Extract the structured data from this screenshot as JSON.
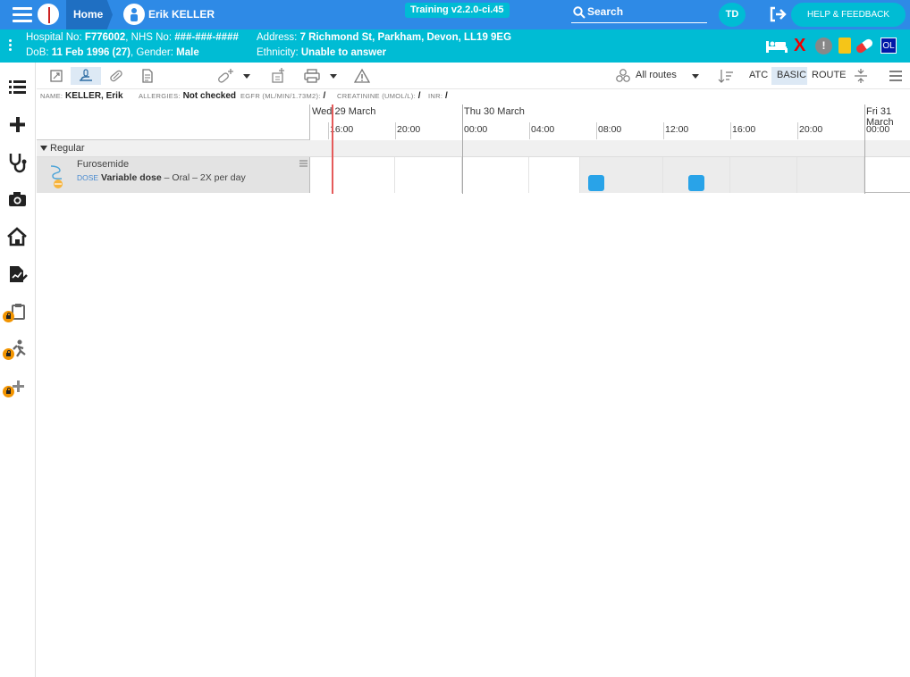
{
  "header": {
    "home_label": "Home",
    "patient_name": "Erik KELLER",
    "build_label": "Training v2.2.0-ci.45",
    "search_label": "Search",
    "user_initials": "TD",
    "help_label": "HELP & FEEDBACK"
  },
  "patient": {
    "hospital_no_label": "Hospital No:",
    "hospital_no": "F776002",
    "nhs_no_label": "NHS No:",
    "nhs_no": "###-###-####",
    "address_label": "Address:",
    "address": "7 Richmond St, Parkham, Devon, LL19 9EG",
    "dob_label": "DoB:",
    "dob": "11 Feb 1996 (27)",
    "gender_label": "Gender:",
    "gender": "Male",
    "ethnicity_label": "Ethnicity:",
    "ethnicity": "Unable to answer",
    "alert_x": "X",
    "alert_exclaim": "!",
    "alert_ol": "OL"
  },
  "toolbar": {
    "routes_label": "All routes",
    "atc_label": "ATC",
    "basic_label": "BASIC",
    "route_label": "ROUTE"
  },
  "infostrip": {
    "name_label": "NAME:",
    "name": "KELLER, Erik",
    "allergies_label": "ALLERGIES:",
    "allergies": "Not checked",
    "egfr_label": "EGFR (ML/MIN/1.73M2):",
    "egfr": "/",
    "creat_label": "CREATININE (UMOL/L):",
    "creat": "/",
    "inr_label": "INR:",
    "inr": "/"
  },
  "timeline": {
    "days": [
      "Wed 29 March",
      "Thu 30 March",
      "Fri 31 March"
    ],
    "hours": [
      "16:00",
      "20:00",
      "00:00",
      "04:00",
      "08:00",
      "12:00",
      "16:00",
      "20:00",
      "00:00"
    ]
  },
  "section_label": "Regular",
  "medication": {
    "name": "Furosemide",
    "dose_tag": "DOSE",
    "dose": "Variable dose",
    "details": "– Oral – 2X per day",
    "scheduled": [
      "08:00",
      "12:00"
    ]
  },
  "colors": {
    "topbar": "#2e8ae6",
    "patient_bar": "#00bcd4",
    "dose_marker": "#29a3e8",
    "now_line": "#e55a5a"
  }
}
